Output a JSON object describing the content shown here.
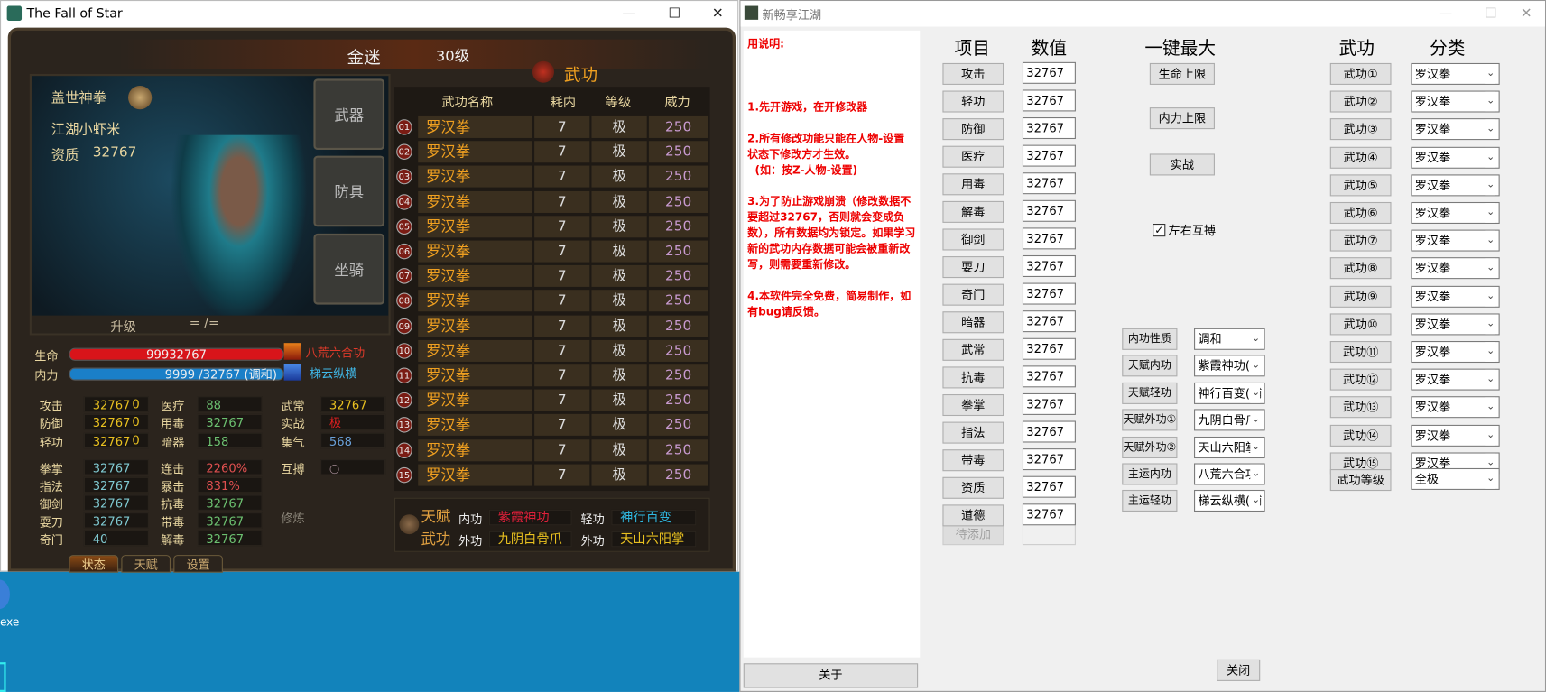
{
  "game_window": {
    "title": "The Fall of Star",
    "controls": {
      "minimize": "—",
      "maximize": "☐",
      "close": "✕"
    },
    "header": {
      "name": "金迷",
      "level": "30级"
    },
    "character": {
      "title": "盖世神拳",
      "nickname": "江湖小虾米",
      "aptitude_label": "资质",
      "aptitude_value": "32767"
    },
    "equip_buttons": [
      "武器",
      "防具",
      "坐骑"
    ],
    "upgrade": {
      "label": "升级",
      "value": "= /="
    },
    "hp": {
      "label": "生命",
      "value": "99932767",
      "fill": 1.0,
      "color": "#d8141a"
    },
    "mp": {
      "label": "内力",
      "value": "9999 /32767 (调和)",
      "fill": 1.0,
      "color": "#1a7fc8"
    },
    "skill_icons": [
      {
        "icon": "fire-figure-icon",
        "name": "八荒六合功",
        "color": "#e03a2a"
      },
      {
        "icon": "blue-wind-icon",
        "name": "梯云纵横",
        "color": "#40b8e8"
      }
    ],
    "stats_col1": [
      {
        "label": "攻击",
        "value": "32767",
        "extra": "0"
      },
      {
        "label": "防御",
        "value": "32767",
        "extra": "0"
      },
      {
        "label": "轻功",
        "value": "32767",
        "extra": "0"
      },
      {
        "label": "拳掌",
        "value": "32767"
      },
      {
        "label": "指法",
        "value": "32767"
      },
      {
        "label": "御剑",
        "value": "32767"
      },
      {
        "label": "耍刀",
        "value": "32767"
      },
      {
        "label": "奇门",
        "value": "40"
      }
    ],
    "stats_col2": [
      {
        "label": "医疗",
        "value": "88"
      },
      {
        "label": "用毒",
        "value": "32767"
      },
      {
        "label": "暗器",
        "value": "158"
      },
      {
        "label": "连击",
        "value": "2260%"
      },
      {
        "label": "暴击",
        "value": "831%"
      },
      {
        "label": "抗毒",
        "value": "32767"
      },
      {
        "label": "带毒",
        "value": "32767"
      },
      {
        "label": "解毒",
        "value": "32767"
      }
    ],
    "stats_col3": [
      {
        "label": "武常",
        "value": "32767"
      },
      {
        "label": "实战",
        "value": "极"
      },
      {
        "label": "集气",
        "value": "568"
      },
      {
        "label": "互搏",
        "value": "○"
      }
    ],
    "cultivate_label": "修炼",
    "martial": {
      "title": "武功",
      "columns": [
        "武功名称",
        "耗内",
        "等级",
        "威力"
      ],
      "rows": [
        {
          "no": "01",
          "name": "罗汉拳",
          "cost": "7",
          "grade": "极",
          "power": "250"
        },
        {
          "no": "02",
          "name": "罗汉拳",
          "cost": "7",
          "grade": "极",
          "power": "250"
        },
        {
          "no": "03",
          "name": "罗汉拳",
          "cost": "7",
          "grade": "极",
          "power": "250"
        },
        {
          "no": "04",
          "name": "罗汉拳",
          "cost": "7",
          "grade": "极",
          "power": "250"
        },
        {
          "no": "05",
          "name": "罗汉拳",
          "cost": "7",
          "grade": "极",
          "power": "250"
        },
        {
          "no": "06",
          "name": "罗汉拳",
          "cost": "7",
          "grade": "极",
          "power": "250"
        },
        {
          "no": "07",
          "name": "罗汉拳",
          "cost": "7",
          "grade": "极",
          "power": "250"
        },
        {
          "no": "08",
          "name": "罗汉拳",
          "cost": "7",
          "grade": "极",
          "power": "250"
        },
        {
          "no": "09",
          "name": "罗汉拳",
          "cost": "7",
          "grade": "极",
          "power": "250"
        },
        {
          "no": "10",
          "name": "罗汉拳",
          "cost": "7",
          "grade": "极",
          "power": "250"
        },
        {
          "no": "11",
          "name": "罗汉拳",
          "cost": "7",
          "grade": "极",
          "power": "250"
        },
        {
          "no": "12",
          "name": "罗汉拳",
          "cost": "7",
          "grade": "极",
          "power": "250"
        },
        {
          "no": "13",
          "name": "罗汉拳",
          "cost": "7",
          "grade": "极",
          "power": "250"
        },
        {
          "no": "14",
          "name": "罗汉拳",
          "cost": "7",
          "grade": "极",
          "power": "250"
        },
        {
          "no": "15",
          "name": "罗汉拳",
          "cost": "7",
          "grade": "极",
          "power": "250"
        }
      ]
    },
    "talent": {
      "label1": "天赋",
      "label2": "武功",
      "inner_label": "内功",
      "inner": "紫霞神功",
      "light_label": "轻功",
      "light": "神行百变",
      "outer1_label": "外功",
      "outer1": "九阴白骨爪",
      "outer2_label": "外功",
      "outer2": "天山六阳掌"
    },
    "tabs": [
      "状态",
      "天赋",
      "设置"
    ]
  },
  "desktop": {
    "icon_label": "exe"
  },
  "modifier_window": {
    "title": "新畅享江湖",
    "controls": {
      "minimize": "—",
      "maximize": "☐",
      "close": "✕"
    },
    "help_text": "用说明:\n\n\n\n1.先开游戏，在开修改器\n\n2.所有修改功能只能在人物-设置 状态下修改方才生效。\n  (如：按Z-人物-设置)\n\n3.为了防止游戏崩溃（修改数据不要超过32767，否则就会变成负数），所有数据均为锁定。如果学习新的武功内存数据可能会被重新改写，则需要重新修改。\n\n4.本软件完全免费，简易制作，如有bug请反馈。",
    "about_button": "关于",
    "close_button": "关闭",
    "headers": {
      "item": "项目",
      "value": "数值",
      "max": "一键最大",
      "martial": "武功",
      "category": "分类"
    },
    "items": [
      {
        "label": "攻击",
        "value": "32767"
      },
      {
        "label": "轻功",
        "value": "32767"
      },
      {
        "label": "防御",
        "value": "32767"
      },
      {
        "label": "医疗",
        "value": "32767"
      },
      {
        "label": "用毒",
        "value": "32767"
      },
      {
        "label": "解毒",
        "value": "32767"
      },
      {
        "label": "御剑",
        "value": "32767"
      },
      {
        "label": "耍刀",
        "value": "32767"
      },
      {
        "label": "奇门",
        "value": "32767"
      },
      {
        "label": "暗器",
        "value": "32767"
      },
      {
        "label": "武常",
        "value": "32767"
      },
      {
        "label": "抗毒",
        "value": "32767"
      },
      {
        "label": "拳掌",
        "value": "32767"
      },
      {
        "label": "指法",
        "value": "32767"
      },
      {
        "label": "带毒",
        "value": "32767"
      },
      {
        "label": "资质",
        "value": "32767"
      },
      {
        "label": "道德",
        "value": "32767"
      }
    ],
    "pending_button": "待添加",
    "max_buttons": [
      "生命上限",
      "内力上限",
      "实战"
    ],
    "mutual_checkbox": {
      "label": "左右互搏",
      "checked": true
    },
    "talent_rows": [
      {
        "label": "内功性质",
        "value": "调和"
      },
      {
        "label": "天赋内功",
        "value": "紫霞神功(阝"
      },
      {
        "label": "天赋轻功",
        "value": "神行百变(辅"
      },
      {
        "label": "天赋外功①",
        "value": "九阴白骨爪"
      },
      {
        "label": "天赋外功②",
        "value": "天山六阳掌"
      },
      {
        "label": "主运内功",
        "value": "八荒六合功"
      },
      {
        "label": "主运轻功",
        "value": "梯云纵横(辅"
      }
    ],
    "martial_rows": [
      {
        "label": "武功①",
        "value": "罗汉拳"
      },
      {
        "label": "武功②",
        "value": "罗汉拳"
      },
      {
        "label": "武功③",
        "value": "罗汉拳"
      },
      {
        "label": "武功④",
        "value": "罗汉拳"
      },
      {
        "label": "武功⑤",
        "value": "罗汉拳"
      },
      {
        "label": "武功⑥",
        "value": "罗汉拳"
      },
      {
        "label": "武功⑦",
        "value": "罗汉拳"
      },
      {
        "label": "武功⑧",
        "value": "罗汉拳"
      },
      {
        "label": "武功⑨",
        "value": "罗汉拳"
      },
      {
        "label": "武功⑩",
        "value": "罗汉拳"
      },
      {
        "label": "武功⑪",
        "value": "罗汉拳"
      },
      {
        "label": "武功⑫",
        "value": "罗汉拳"
      },
      {
        "label": "武功⑬",
        "value": "罗汉拳"
      },
      {
        "label": "武功⑭",
        "value": "罗汉拳"
      },
      {
        "label": "武功⑮",
        "value": "罗汉拳"
      }
    ],
    "martial_level": {
      "label": "武功等级",
      "value": "全极"
    }
  }
}
